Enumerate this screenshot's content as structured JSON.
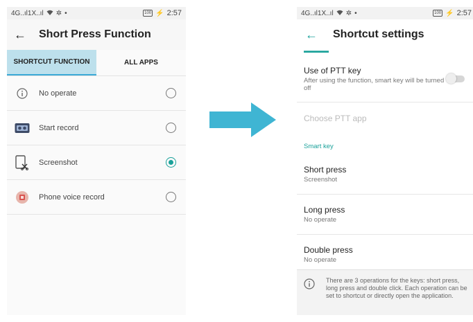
{
  "status_bar": {
    "signal": "4G..ıl1X..ıl",
    "battery": "100",
    "time": "2:57"
  },
  "left_screen": {
    "title": "Short Press Function",
    "tabs": [
      {
        "label": "SHORTCUT FUNCTION",
        "active": true
      },
      {
        "label": "ALL APPS",
        "active": false
      }
    ],
    "options": [
      {
        "label": "No operate",
        "icon": "info-icon",
        "selected": false
      },
      {
        "label": "Start record",
        "icon": "recorder-icon",
        "selected": false
      },
      {
        "label": "Screenshot",
        "icon": "screenshot-icon",
        "selected": true
      },
      {
        "label": "Phone voice record",
        "icon": "phone-voice-record-icon",
        "selected": false
      }
    ]
  },
  "right_screen": {
    "title": "Shortcut settings",
    "ptt": {
      "title": "Use of PTT key",
      "subtitle": "After using the function, smart key will be turned off",
      "enabled": false
    },
    "choose_ptt_app": "Choose PTT app",
    "smart_key_header": "Smart key",
    "presses": [
      {
        "title": "Short press",
        "value": "Screenshot"
      },
      {
        "title": "Long press",
        "value": "No operate"
      },
      {
        "title": "Double press",
        "value": "No operate"
      }
    ],
    "info": "There are 3 operations for the keys: short press, long press and double click. Each operation can be set to shortcut or directly open the application."
  },
  "colors": {
    "accent": "#1aa19a",
    "tab_active_bg": "#bde0ec",
    "arrow": "#3fb5d3"
  }
}
